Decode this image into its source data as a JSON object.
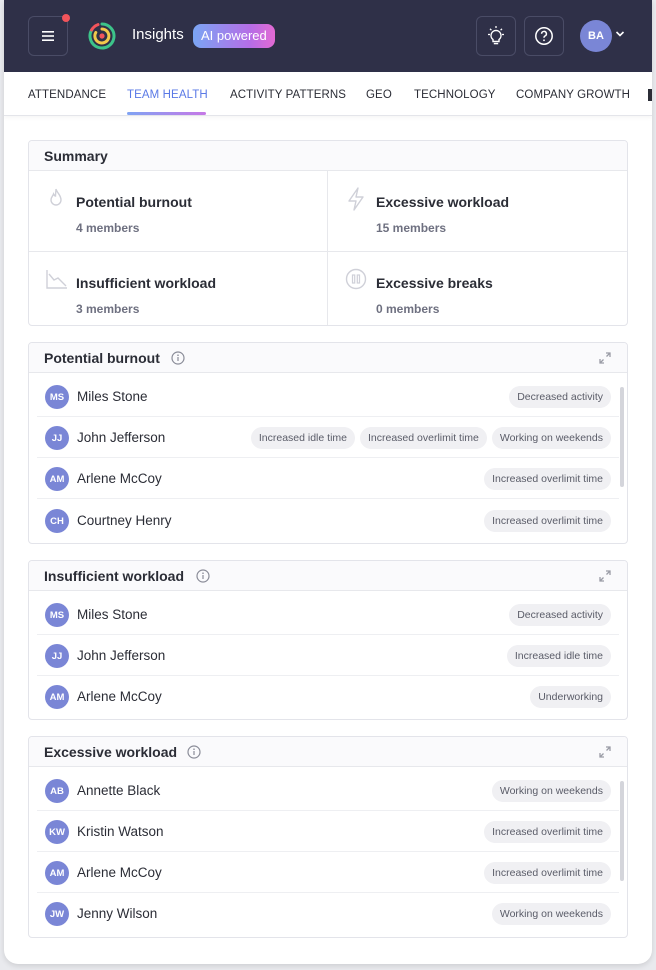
{
  "header": {
    "app_title": "Insights",
    "ai_badge": "AI powered",
    "user_initials": "BA",
    "brand_color": "#2f3048",
    "accent_color": "#5a79e6"
  },
  "tabs": [
    {
      "label": "ATTENDANCE"
    },
    {
      "label": "TEAM HEALTH",
      "active": true
    },
    {
      "label": "ACTIVITY PATTERNS"
    },
    {
      "label": "GEO"
    },
    {
      "label": "TECHNOLOGY"
    },
    {
      "label": "COMPANY GROWTH"
    }
  ],
  "summary": {
    "title": "Summary",
    "items": [
      {
        "title": "Potential burnout",
        "count": "4 members",
        "icon": "flame-icon"
      },
      {
        "title": "Excessive workload",
        "count": "15 members",
        "icon": "lightning-icon"
      },
      {
        "title": "Insufficient workload",
        "count": "3 members",
        "icon": "trend-down-icon"
      },
      {
        "title": "Excessive breaks",
        "count": "0 members",
        "icon": "pause-icon"
      }
    ]
  },
  "potential_burnout": {
    "title": "Potential burnout",
    "rows": [
      {
        "initials": "MS",
        "name": "Miles Stone",
        "tags": [
          "Decreased activity"
        ]
      },
      {
        "initials": "JJ",
        "name": "John Jefferson",
        "tags": [
          "Increased idle time",
          "Increased overlimit time",
          "Working on weekends"
        ]
      },
      {
        "initials": "AM",
        "name": "Arlene McCoy",
        "tags": [
          "Increased overlimit time"
        ]
      },
      {
        "initials": "CH",
        "name": "Courtney Henry",
        "tags": [
          "Increased overlimit time"
        ]
      }
    ]
  },
  "insufficient_workload": {
    "title": "Insufficient workload",
    "rows": [
      {
        "initials": "MS",
        "name": "Miles Stone",
        "tags": [
          "Decreased activity"
        ]
      },
      {
        "initials": "JJ",
        "name": "John Jefferson",
        "tags": [
          "Increased idle time"
        ]
      },
      {
        "initials": "AM",
        "name": "Arlene McCoy",
        "tags": [
          "Underworking"
        ]
      }
    ]
  },
  "excessive_workload": {
    "title": "Excessive workload",
    "rows": [
      {
        "initials": "AB",
        "name": "Annette Black",
        "tags": [
          "Working on weekends"
        ]
      },
      {
        "initials": "KW",
        "name": "Kristin Watson",
        "tags": [
          "Increased overlimit time"
        ]
      },
      {
        "initials": "AM",
        "name": "Arlene McCoy",
        "tags": [
          "Increased overlimit time"
        ]
      },
      {
        "initials": "JW",
        "name": "Jenny Wilson",
        "tags": [
          "Working on weekends"
        ]
      }
    ]
  }
}
